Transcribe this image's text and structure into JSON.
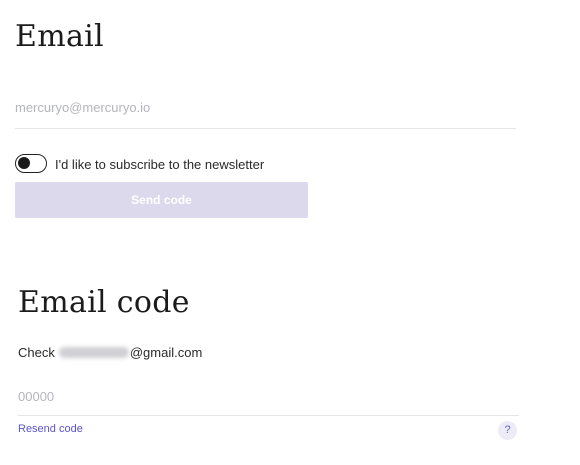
{
  "email_section": {
    "title": "Email",
    "email_placeholder": "mercuryo@mercuryo.io",
    "email_value": "",
    "newsletter_label": "I'd like to subscribe to the newsletter",
    "newsletter_enabled": false,
    "send_button_label": "Send code",
    "send_button_color": "#dcd9ec"
  },
  "code_section": {
    "title": "Email code",
    "check_prefix": "Check",
    "check_suffix": "@gmail.com",
    "code_placeholder": "00000",
    "code_value": "",
    "resend_label": "Resend code",
    "help_label": "?",
    "link_color": "#5c55c8"
  }
}
